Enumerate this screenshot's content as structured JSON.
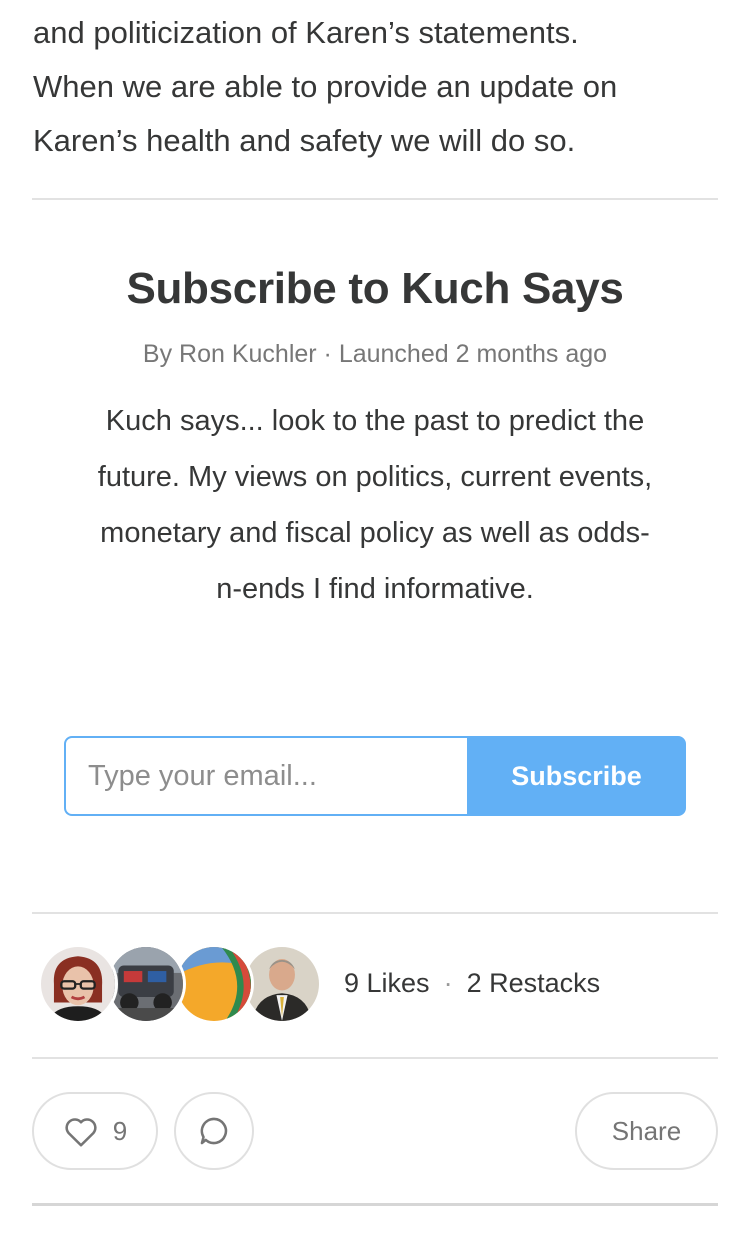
{
  "article": {
    "lines": [
      "and politicization of Karen’s statements.",
      "When we are able to provide an update on",
      "Karen’s health and safety we will do so."
    ]
  },
  "subscribe": {
    "title": "Subscribe to Kuch Says",
    "byline": "By Ron Kuchler · Launched 2 months ago",
    "description": "Kuch says... look to the past to predict the future. My views on politics, current events, monetary and fiscal policy as well as odds-n-ends I find informative.",
    "email_placeholder": "Type your email...",
    "button_label": "Subscribe",
    "accent_color": "#62b0f5"
  },
  "engagement": {
    "likes": "9 Likes",
    "separator": "·",
    "restacks": "2 Restacks",
    "avatars": [
      "avatar-woman-glasses",
      "avatar-vehicle-photo",
      "avatar-colorful-abstract",
      "avatar-man-suit"
    ]
  },
  "actions": {
    "like_count": "9",
    "like_icon": "heart-icon",
    "comment_icon": "comment-icon",
    "share_label": "Share"
  }
}
